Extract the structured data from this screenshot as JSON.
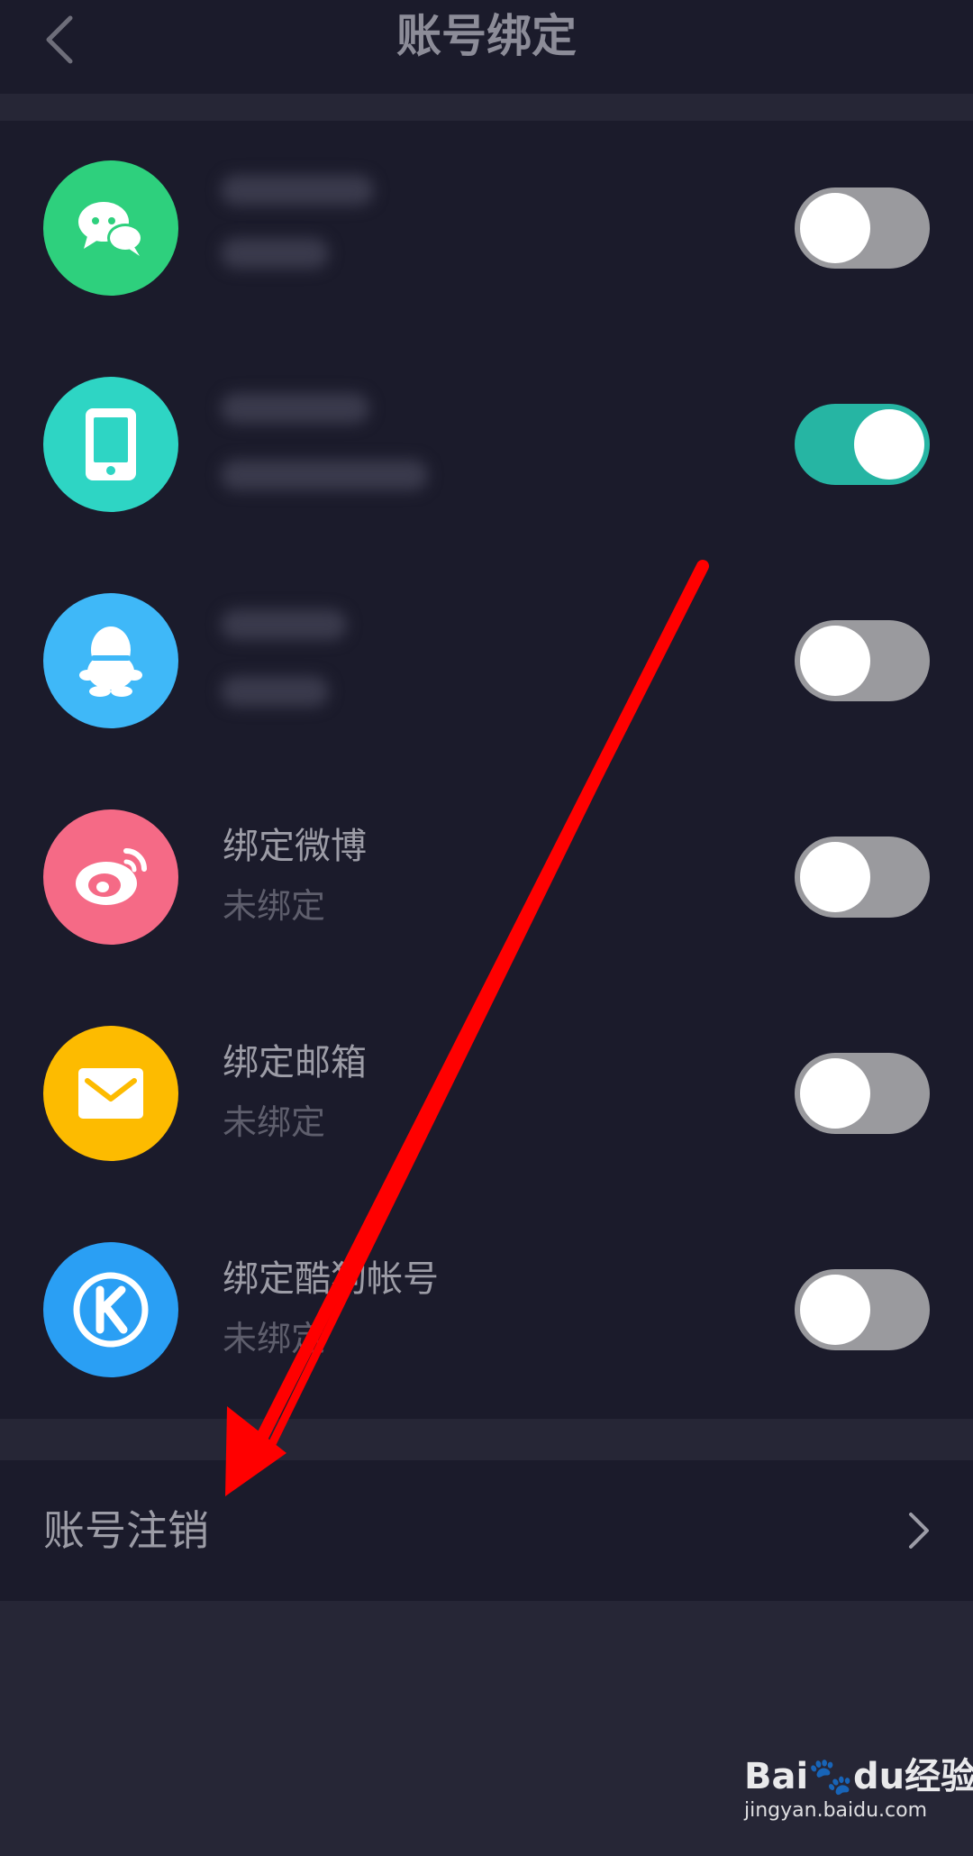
{
  "header": {
    "title": "账号绑定"
  },
  "accounts": [
    {
      "title": "",
      "status": "",
      "icon": "wechat-icon",
      "color": "#2ed07d",
      "enabled": false,
      "redacted": true
    },
    {
      "title": "",
      "status": "",
      "icon": "phone-icon",
      "color": "#2ed5c4",
      "enabled": true,
      "redacted": true
    },
    {
      "title": "",
      "status": "",
      "icon": "qq-icon",
      "color": "#3fb8f8",
      "enabled": false,
      "redacted": true
    },
    {
      "title": "绑定微博",
      "status": "未绑定",
      "icon": "weibo-icon",
      "color": "#f56a86",
      "enabled": false,
      "redacted": false
    },
    {
      "title": "绑定邮箱",
      "status": "未绑定",
      "icon": "mail-icon",
      "color": "#fdbb00",
      "enabled": false,
      "redacted": false
    },
    {
      "title": "绑定酷狗帐号",
      "status": "未绑定",
      "icon": "kugou-icon",
      "color": "#2a9ff4",
      "enabled": false,
      "redacted": false
    }
  ],
  "cancel": {
    "label": "账号注销"
  },
  "watermark": {
    "brand_a": "Bai",
    "brand_b": "du",
    "brand_c": "经验",
    "url": "jingyan.baidu.com"
  },
  "colors": {
    "background": "#1b1b2b",
    "divider": "#262636",
    "toggle_on": "#26b5a3",
    "toggle_off": "#9a9a9e",
    "annotation_arrow": "#ff0000"
  }
}
